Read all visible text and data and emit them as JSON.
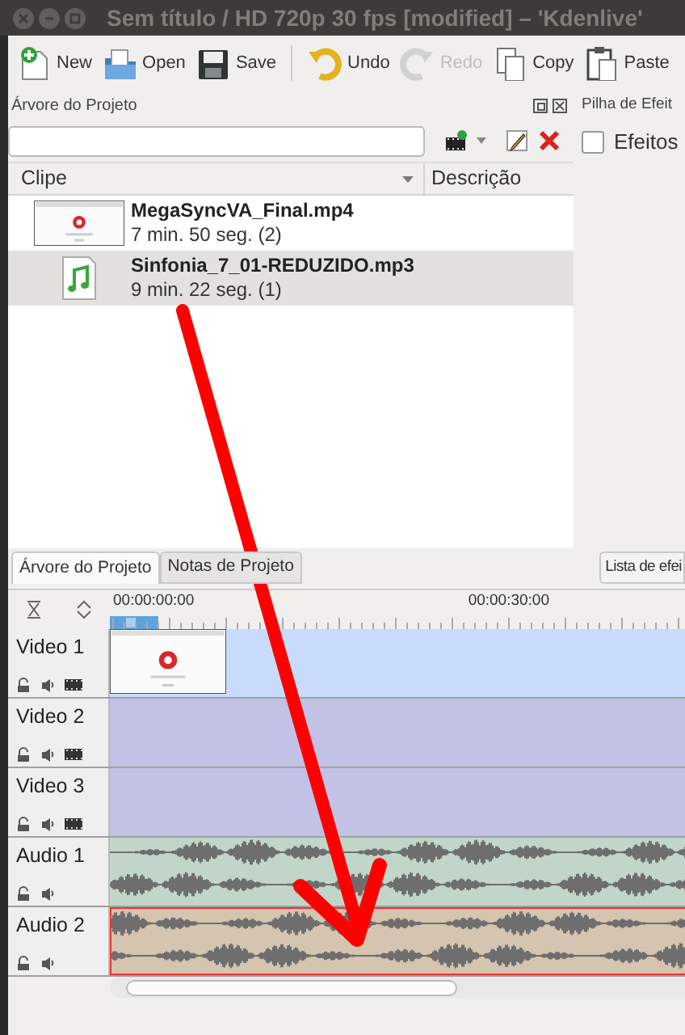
{
  "window": {
    "title": "Sem título / HD 720p 30 fps [modified] – 'Kdenlive'"
  },
  "toolbar": [
    {
      "kind": "new",
      "label": "New",
      "disabled": false
    },
    {
      "kind": "open",
      "label": "Open",
      "disabled": false
    },
    {
      "kind": "save",
      "label": "Save",
      "disabled": false
    },
    {
      "kind": "undo",
      "label": "Undo",
      "disabled": false
    },
    {
      "kind": "redo",
      "label": "Redo",
      "disabled": true
    },
    {
      "kind": "copy",
      "label": "Copy",
      "disabled": false
    },
    {
      "kind": "paste",
      "label": "Paste",
      "disabled": false
    }
  ],
  "project_panel": {
    "title": "Árvore do Projeto",
    "columns": [
      "Clipe",
      "Descrição"
    ],
    "clips": [
      {
        "kind": "video",
        "name": "MegaSyncVA_Final.mp4",
        "duration": "7 min. 50 seg. (2)",
        "selected": false
      },
      {
        "kind": "audio",
        "name": "Sinfonia_7_01-REDUZIDO.mp3",
        "duration": "9 min. 22 seg. (1)",
        "selected": true
      }
    ]
  },
  "effects_panel": {
    "title": "Pilha de Efeit",
    "checkbox": {
      "label": "Efeitos",
      "checked": false
    }
  },
  "tabs": [
    {
      "label": "Árvore do Projeto",
      "selected": true
    },
    {
      "label": "Notas de Projeto",
      "selected": false
    }
  ],
  "right_tab": "Lista de efei",
  "timeline": {
    "timecodes": [
      "00:00:00:00",
      "00:00:30:00"
    ],
    "tracks": [
      {
        "kind": "video",
        "name": "Video 1",
        "has_clip": true,
        "selected": false
      },
      {
        "kind": "video",
        "name": "Video 2",
        "has_clip": false,
        "selected": false
      },
      {
        "kind": "video",
        "name": "Video 3",
        "has_clip": false,
        "selected": false
      },
      {
        "kind": "audio",
        "name": "Audio 1",
        "has_clip": true,
        "selected": false
      },
      {
        "kind": "audio",
        "name": "Audio 2",
        "has_clip": true,
        "selected": true
      }
    ]
  }
}
